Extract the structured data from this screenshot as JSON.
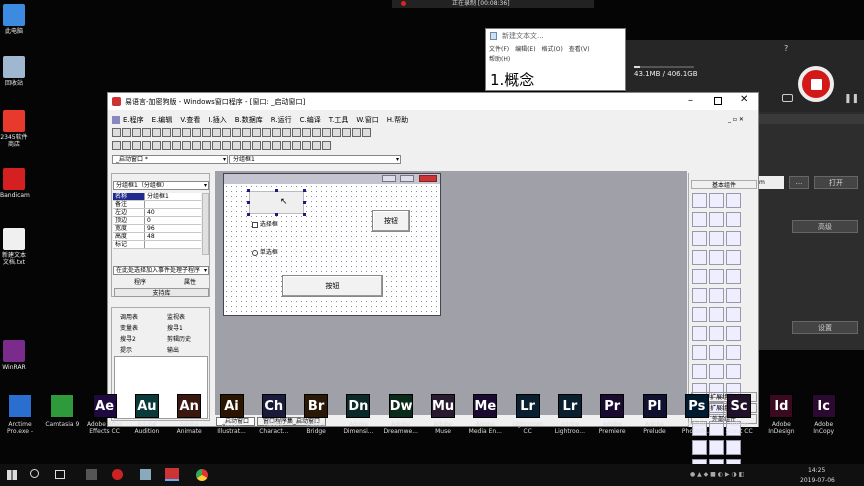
{
  "recorder_bar": {
    "status": "正在录制 [00:08:36]"
  },
  "desktop_icons": [
    {
      "label": "此电脑",
      "color": "#3d8be0"
    },
    {
      "label": "回收站",
      "color": "#9fb8d0"
    },
    {
      "label": "2345软件商店",
      "color": "#e8392d"
    },
    {
      "label": "Bandicam",
      "color": "#d42020"
    },
    {
      "label": "新建文本文档.txt",
      "color": "#f0f0f0"
    },
    {
      "label": "WinRAR",
      "color": "#7a2b8c"
    }
  ],
  "dock": [
    {
      "abbr": "",
      "label": "Arctime\nPro.exe -",
      "color": "#2a6fd0"
    },
    {
      "abbr": "",
      "label": "Camtasia 9",
      "color": "#2e9a3c"
    },
    {
      "abbr": "Ae",
      "label": "Adobe After\nEffects CC",
      "color": "#1f0a40"
    },
    {
      "abbr": "Au",
      "label": "Adobe\nAudition",
      "color": "#0a3a3a"
    },
    {
      "abbr": "An",
      "label": "Adobe\nAnimate",
      "color": "#3a1810"
    },
    {
      "abbr": "Ai",
      "label": "Adobe\nIllustrat...",
      "color": "#2b1500"
    },
    {
      "abbr": "Ch",
      "label": "Adobe\nCharact...",
      "color": "#1a1a3a"
    },
    {
      "abbr": "Br",
      "label": "Adobe\nBridge",
      "color": "#2a1a05"
    },
    {
      "abbr": "Dn",
      "label": "Adobe\nDimensi...",
      "color": "#0a2a2a"
    },
    {
      "abbr": "Dw",
      "label": "Adobe\nDreamwe...",
      "color": "#0a2a1a"
    },
    {
      "abbr": "Mu",
      "label": "Adobe\nMuse",
      "color": "#2a1a30"
    },
    {
      "abbr": "Me",
      "label": "Adobe\nMedia En...",
      "color": "#1a0a30"
    },
    {
      "abbr": "Lr",
      "label": "Lightroom\nCC",
      "color": "#0a2030"
    },
    {
      "abbr": "Lr",
      "label": "Adobe\nLightroo...",
      "color": "#0a2030"
    },
    {
      "abbr": "Pr",
      "label": "Adobe\nPremiere",
      "color": "#1a0a30"
    },
    {
      "abbr": "Pl",
      "label": "Adobe\nPrelude",
      "color": "#101030"
    },
    {
      "abbr": "Ps",
      "label": "Adobe\nPhotosh...",
      "color": "#001a30"
    },
    {
      "abbr": "Sc",
      "label": "Adobe\nScout CC",
      "color": "#20102a"
    },
    {
      "abbr": "Id",
      "label": "Adobe\nInDesign",
      "color": "#3a0a20"
    },
    {
      "abbr": "Ic",
      "label": "Adobe\nInCopy",
      "color": "#2a0a30"
    }
  ],
  "notepad": {
    "title": "新建文本文...",
    "menu": [
      "文件(F)",
      "编辑(E)",
      "格式(O)",
      "查看(V)",
      "帮助(H)"
    ],
    "content": "1.概念"
  },
  "right_panel": {
    "storage": "43.1MB / 406.1GB",
    "open": "打开",
    "advanced": "高级",
    "settings": "设置",
    "dots": "..."
  },
  "main": {
    "title": "易语言-加密狗版 - Windows窗口程序 - [窗口: _启动窗口]",
    "menu": [
      "E.程序",
      "E.编辑",
      "V.查看",
      "I.插入",
      "B.数据库",
      "R.运行",
      "C.编译",
      "T.工具",
      "W.窗口",
      "H.帮助"
    ],
    "combo_window": "_启动窗口 *",
    "combo_component": "分组框1",
    "prop_panel": {
      "combo": "分组框1（分组框）",
      "rows": [
        [
          "名称",
          "分组框1"
        ],
        [
          "备注",
          ""
        ],
        [
          "左边",
          "40"
        ],
        [
          "顶边",
          "0"
        ],
        [
          "宽度",
          "96"
        ],
        [
          "高度",
          "48"
        ],
        [
          "标记",
          ""
        ]
      ],
      "event_combo": "在此处选择加入事件处理子程序",
      "tab1": "程序",
      "tab2": "属性",
      "tab3": "支持库"
    },
    "bottom_panel": {
      "items": [
        [
          "调用表",
          "监视表"
        ],
        [
          "变量表",
          "搜寻1"
        ],
        [
          "搜寻2",
          "剪辑历史"
        ],
        [
          "提示",
          "输出"
        ]
      ]
    },
    "designer": {
      "checkbox": "选择框",
      "radio": "单选框",
      "btn1": "按钮",
      "btn2": "按钮"
    },
    "tabs": [
      "_启动窗口",
      "窗口程序集_启动窗口"
    ],
    "toolbox": {
      "title": "基本组件",
      "tabs": [
        "扩展组件1",
        "扩展组件2",
        "外部组件"
      ]
    }
  },
  "taskbar": {
    "time": "14:25",
    "date": "2019-07-06"
  }
}
